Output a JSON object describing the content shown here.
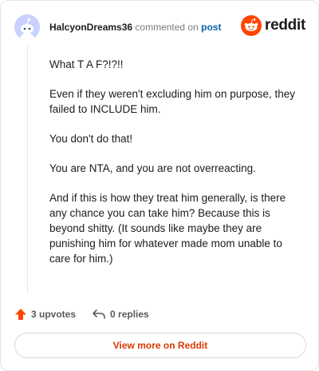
{
  "comment": {
    "author": "HalcyonDreams36",
    "action_text": "commented on",
    "post_link": "post",
    "paragraphs": [
      "What T A F?!?!!",
      "Even if they weren't excluding him on purpose, they failed to INCLUDE him.",
      "You don't do that!",
      "You are NTA, and you are not overreacting.",
      "And if this is how they treat him generally, is there any chance you can take him? Because this is beyond shitty. (It sounds like maybe they are punishing him for whatever made mom unable to care for him.)"
    ]
  },
  "brand": {
    "name": "reddit",
    "color": "#ff4500"
  },
  "actions": {
    "upvotes": "3 upvotes",
    "replies": "0 replies",
    "upvote_color": "#ff4500"
  },
  "footer": {
    "view_more": "View more on Reddit"
  }
}
